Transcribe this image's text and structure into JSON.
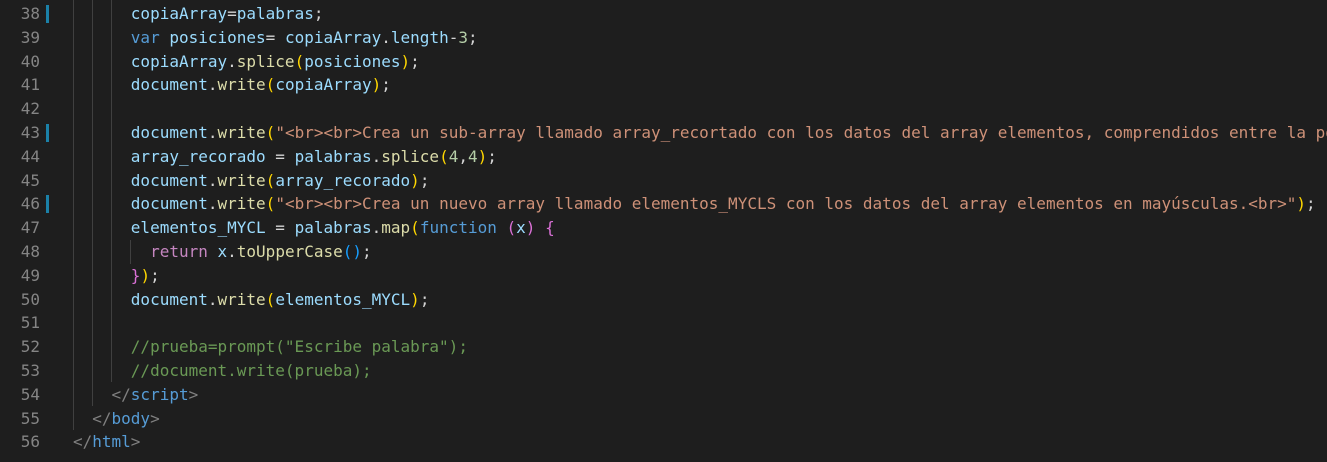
{
  "editor": {
    "lines": [
      {
        "number": "38",
        "modified": true,
        "indent": "      ",
        "tokens": [
          {
            "t": "copiaArray",
            "c": "t-var"
          },
          {
            "t": "=",
            "c": "t-plain"
          },
          {
            "t": "palabras",
            "c": "t-var"
          },
          {
            "t": ";",
            "c": "t-plain"
          }
        ]
      },
      {
        "number": "39",
        "modified": false,
        "indent": "      ",
        "tokens": [
          {
            "t": "var",
            "c": "t-kw"
          },
          {
            "t": " ",
            "c": "t-plain"
          },
          {
            "t": "posiciones",
            "c": "t-var"
          },
          {
            "t": "= ",
            "c": "t-plain"
          },
          {
            "t": "copiaArray",
            "c": "t-var"
          },
          {
            "t": ".",
            "c": "t-plain"
          },
          {
            "t": "length",
            "c": "t-var"
          },
          {
            "t": "-",
            "c": "t-plain"
          },
          {
            "t": "3",
            "c": "t-num"
          },
          {
            "t": ";",
            "c": "t-plain"
          }
        ]
      },
      {
        "number": "40",
        "modified": false,
        "indent": "      ",
        "tokens": [
          {
            "t": "copiaArray",
            "c": "t-var"
          },
          {
            "t": ".",
            "c": "t-plain"
          },
          {
            "t": "splice",
            "c": "t-fn"
          },
          {
            "t": "(",
            "c": "t-br1"
          },
          {
            "t": "posiciones",
            "c": "t-var"
          },
          {
            "t": ")",
            "c": "t-br1"
          },
          {
            "t": ";",
            "c": "t-plain"
          }
        ]
      },
      {
        "number": "41",
        "modified": false,
        "indent": "      ",
        "tokens": [
          {
            "t": "document",
            "c": "t-var"
          },
          {
            "t": ".",
            "c": "t-plain"
          },
          {
            "t": "write",
            "c": "t-fn"
          },
          {
            "t": "(",
            "c": "t-br1"
          },
          {
            "t": "copiaArray",
            "c": "t-var"
          },
          {
            "t": ")",
            "c": "t-br1"
          },
          {
            "t": ";",
            "c": "t-plain"
          }
        ]
      },
      {
        "number": "42",
        "modified": false,
        "indent": "",
        "tokens": []
      },
      {
        "number": "43",
        "modified": true,
        "indent": "      ",
        "tokens": [
          {
            "t": "document",
            "c": "t-var"
          },
          {
            "t": ".",
            "c": "t-plain"
          },
          {
            "t": "write",
            "c": "t-fn"
          },
          {
            "t": "(",
            "c": "t-br1"
          },
          {
            "t": "\"<br><br>Crea un sub-array llamado array_recortado con los datos del array elementos, comprendidos entre la po",
            "c": "t-str"
          }
        ]
      },
      {
        "number": "44",
        "modified": false,
        "indent": "      ",
        "tokens": [
          {
            "t": "array_recorado",
            "c": "t-var"
          },
          {
            "t": " = ",
            "c": "t-plain"
          },
          {
            "t": "palabras",
            "c": "t-var"
          },
          {
            "t": ".",
            "c": "t-plain"
          },
          {
            "t": "splice",
            "c": "t-fn"
          },
          {
            "t": "(",
            "c": "t-br1"
          },
          {
            "t": "4",
            "c": "t-num"
          },
          {
            "t": ",",
            "c": "t-plain"
          },
          {
            "t": "4",
            "c": "t-num"
          },
          {
            "t": ")",
            "c": "t-br1"
          },
          {
            "t": ";",
            "c": "t-plain"
          }
        ]
      },
      {
        "number": "45",
        "modified": false,
        "indent": "      ",
        "tokens": [
          {
            "t": "document",
            "c": "t-var"
          },
          {
            "t": ".",
            "c": "t-plain"
          },
          {
            "t": "write",
            "c": "t-fn"
          },
          {
            "t": "(",
            "c": "t-br1"
          },
          {
            "t": "array_recorado",
            "c": "t-var"
          },
          {
            "t": ")",
            "c": "t-br1"
          },
          {
            "t": ";",
            "c": "t-plain"
          }
        ]
      },
      {
        "number": "46",
        "modified": true,
        "indent": "      ",
        "tokens": [
          {
            "t": "document",
            "c": "t-var"
          },
          {
            "t": ".",
            "c": "t-plain"
          },
          {
            "t": "write",
            "c": "t-fn"
          },
          {
            "t": "(",
            "c": "t-br1"
          },
          {
            "t": "\"<br><br>Crea un nuevo array llamado elementos_MYCLS con los datos del array elementos en mayúsculas.<br>\"",
            "c": "t-str"
          },
          {
            "t": ")",
            "c": "t-br1"
          },
          {
            "t": ";",
            "c": "t-plain"
          }
        ]
      },
      {
        "number": "47",
        "modified": false,
        "indent": "      ",
        "tokens": [
          {
            "t": "elementos_MYCL",
            "c": "t-var"
          },
          {
            "t": " = ",
            "c": "t-plain"
          },
          {
            "t": "palabras",
            "c": "t-var"
          },
          {
            "t": ".",
            "c": "t-plain"
          },
          {
            "t": "map",
            "c": "t-fn"
          },
          {
            "t": "(",
            "c": "t-br1"
          },
          {
            "t": "function",
            "c": "t-kw"
          },
          {
            "t": " ",
            "c": "t-plain"
          },
          {
            "t": "(",
            "c": "t-br2"
          },
          {
            "t": "x",
            "c": "t-var"
          },
          {
            "t": ")",
            "c": "t-br2"
          },
          {
            "t": " ",
            "c": "t-plain"
          },
          {
            "t": "{",
            "c": "t-br2"
          }
        ]
      },
      {
        "number": "48",
        "modified": false,
        "indent": "        ",
        "tokens": [
          {
            "t": "return",
            "c": "t-ctl"
          },
          {
            "t": " ",
            "c": "t-plain"
          },
          {
            "t": "x",
            "c": "t-var"
          },
          {
            "t": ".",
            "c": "t-plain"
          },
          {
            "t": "toUpperCase",
            "c": "t-fn"
          },
          {
            "t": "(",
            "c": "t-br3"
          },
          {
            "t": ")",
            "c": "t-br3"
          },
          {
            "t": ";",
            "c": "t-plain"
          }
        ]
      },
      {
        "number": "49",
        "modified": false,
        "indent": "      ",
        "tokens": [
          {
            "t": "}",
            "c": "t-br2"
          },
          {
            "t": ")",
            "c": "t-br1"
          },
          {
            "t": ";",
            "c": "t-plain"
          }
        ]
      },
      {
        "number": "50",
        "modified": false,
        "indent": "      ",
        "tokens": [
          {
            "t": "document",
            "c": "t-var"
          },
          {
            "t": ".",
            "c": "t-plain"
          },
          {
            "t": "write",
            "c": "t-fn"
          },
          {
            "t": "(",
            "c": "t-br1"
          },
          {
            "t": "elementos_MYCL",
            "c": "t-var"
          },
          {
            "t": ")",
            "c": "t-br1"
          },
          {
            "t": ";",
            "c": "t-plain"
          }
        ]
      },
      {
        "number": "51",
        "modified": false,
        "indent": "",
        "tokens": []
      },
      {
        "number": "52",
        "modified": false,
        "indent": "      ",
        "tokens": [
          {
            "t": "//prueba=prompt(\"Escribe palabra\");",
            "c": "t-com"
          }
        ]
      },
      {
        "number": "53",
        "modified": false,
        "indent": "      ",
        "tokens": [
          {
            "t": "//document.write(prueba);",
            "c": "t-com"
          }
        ]
      },
      {
        "number": "54",
        "modified": false,
        "indent": "    ",
        "tokens": [
          {
            "t": "</",
            "c": "t-punc"
          },
          {
            "t": "script",
            "c": "t-tag"
          },
          {
            "t": ">",
            "c": "t-punc"
          }
        ]
      },
      {
        "number": "55",
        "modified": false,
        "indent": "  ",
        "tokens": [
          {
            "t": "</",
            "c": "t-punc"
          },
          {
            "t": "body",
            "c": "t-tag"
          },
          {
            "t": ">",
            "c": "t-punc"
          }
        ]
      },
      {
        "number": "56",
        "modified": false,
        "indent": "",
        "tokens": [
          {
            "t": "</",
            "c": "t-punc"
          },
          {
            "t": "html",
            "c": "t-tag"
          },
          {
            "t": ">",
            "c": "t-punc"
          }
        ]
      }
    ]
  }
}
